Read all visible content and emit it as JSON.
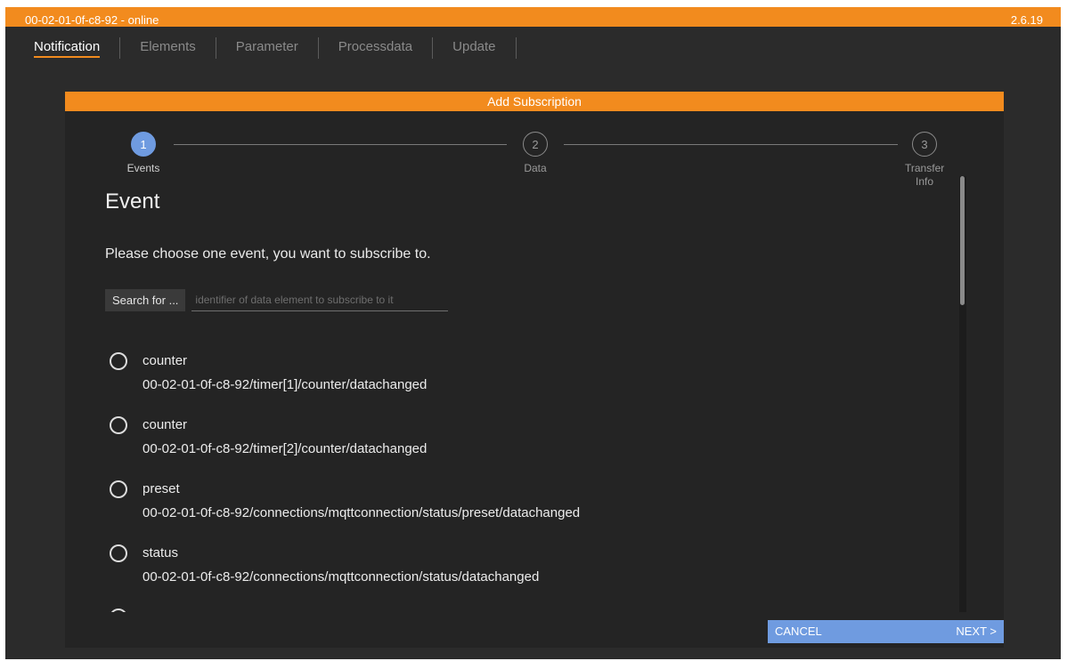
{
  "window": {
    "title": "00-02-01-0f-c8-92 - online",
    "version": "2.6.19"
  },
  "nav": {
    "tabs": [
      "Notification",
      "Elements",
      "Parameter",
      "Processdata",
      "Update"
    ]
  },
  "dialog": {
    "title": "Add Subscription",
    "steps": [
      {
        "number": "1",
        "label": "Events"
      },
      {
        "number": "2",
        "label": "Data"
      },
      {
        "number": "3",
        "label": "Transfer Info"
      }
    ],
    "section_title": "Event",
    "instruction": "Please choose one event, you want to subscribe to.",
    "search": {
      "button_label": "Search for ...",
      "placeholder": "identifier of data element to subscribe to it"
    },
    "events": [
      {
        "name": "counter",
        "path": "00-02-01-0f-c8-92/timer[1]/counter/datachanged"
      },
      {
        "name": "counter",
        "path": "00-02-01-0f-c8-92/timer[2]/counter/datachanged"
      },
      {
        "name": "preset",
        "path": "00-02-01-0f-c8-92/connections/mqttconnection/status/preset/datachanged"
      },
      {
        "name": "status",
        "path": "00-02-01-0f-c8-92/connections/mqttconnection/status/datachanged"
      }
    ],
    "footer": {
      "cancel_label": "CANCEL",
      "next_label": "NEXT >"
    }
  },
  "colors": {
    "accent": "#f28b1e",
    "step_active": "#6f9be0",
    "background": "#2b2b2b"
  }
}
